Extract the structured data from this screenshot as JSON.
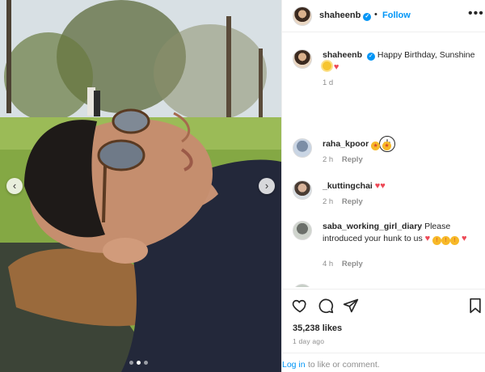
{
  "post": {
    "photo_alt": "",
    "carousel_dots": 3,
    "carousel_active_index": 1
  },
  "header": {
    "username": "shaheenb",
    "separator": "•",
    "follow_label": "Follow",
    "more_label": "•••"
  },
  "caption": {
    "username": "shaheenb",
    "text": "Happy Birthday, Sunshine",
    "time": "1 d"
  },
  "comments": [
    {
      "username": "raha_kpoor",
      "time": "2 h",
      "reply": "Reply"
    },
    {
      "username": "_kuttingchai",
      "time": "2 h",
      "reply": "Reply"
    },
    {
      "username": "saba_working_girl_diary",
      "text": "Please introduced your hunk to us",
      "time": "4 h",
      "reply": "Reply"
    }
  ],
  "stats": {
    "likes": "35,238 likes",
    "date": "1 day ago"
  },
  "login": {
    "link": "Log in",
    "rest": "to like or comment."
  },
  "colors": {
    "accent": "#0095f6",
    "heart": "#ed4956",
    "muted": "#8e8e8e"
  },
  "icons": [
    "heart-icon",
    "comment-icon",
    "share-icon",
    "bookmark-icon",
    "plus-circle-icon",
    "verified-icon",
    "more-icon",
    "chevron-left-icon",
    "chevron-right-icon"
  ]
}
